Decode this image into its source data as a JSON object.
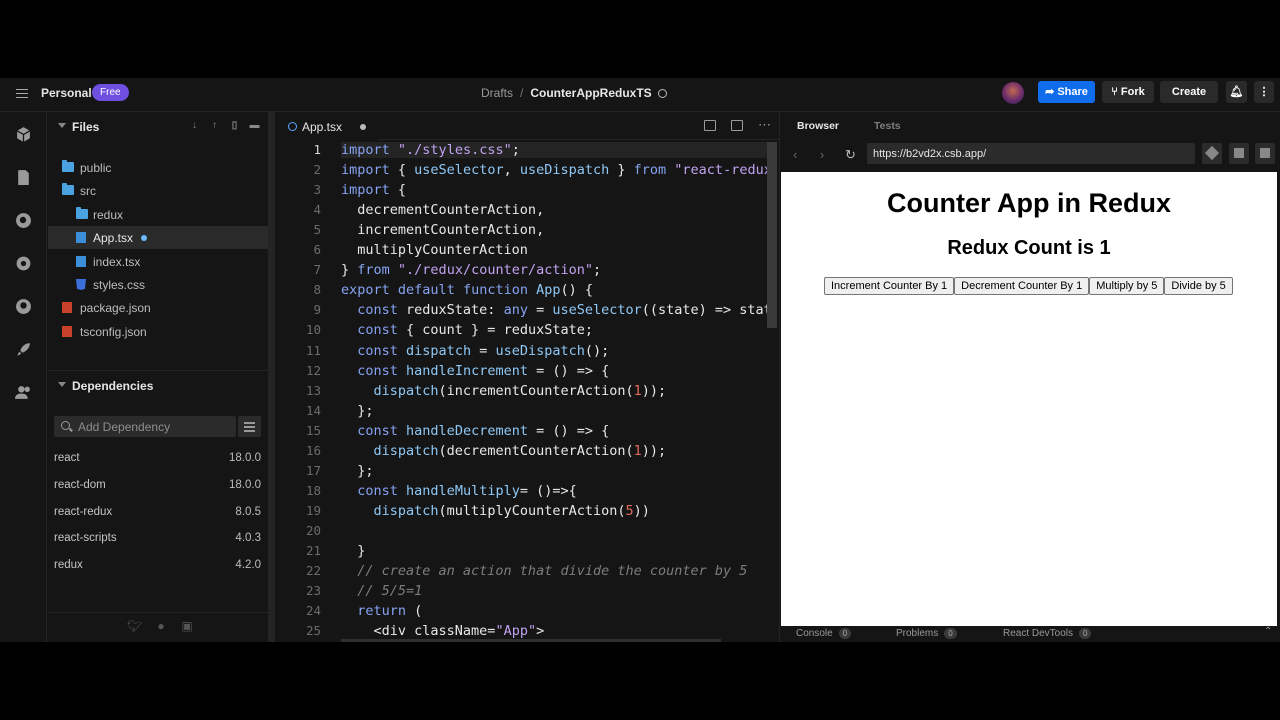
{
  "topbar": {
    "workspace": "Personal",
    "plan_badge": "Free",
    "breadcrumb_parent": "Drafts",
    "breadcrumb_sep": "/",
    "sandbox_name": "CounterAppReduxTS",
    "share_label": "Share",
    "fork_label": "Fork",
    "create_label": "Create"
  },
  "activity_icons": [
    "box-icon",
    "file-icon",
    "search-icon",
    "gear-icon",
    "github-icon",
    "rocket-icon",
    "users-icon"
  ],
  "files": {
    "header": "Files",
    "items": [
      {
        "name": "public",
        "kind": "folder",
        "depth": 0
      },
      {
        "name": "src",
        "kind": "folder",
        "depth": 0
      },
      {
        "name": "redux",
        "kind": "folder",
        "depth": 1
      },
      {
        "name": "App.tsx",
        "kind": "tsx",
        "depth": 1,
        "selected": true,
        "modified": true
      },
      {
        "name": "index.tsx",
        "kind": "tsx",
        "depth": 1
      },
      {
        "name": "styles.css",
        "kind": "css",
        "depth": 1
      },
      {
        "name": "package.json",
        "kind": "json",
        "depth": 0
      },
      {
        "name": "tsconfig.json",
        "kind": "json",
        "depth": 0
      }
    ]
  },
  "dependencies": {
    "header": "Dependencies",
    "search_placeholder": "Add Dependency",
    "items": [
      {
        "name": "react",
        "version": "18.0.0"
      },
      {
        "name": "react-dom",
        "version": "18.0.0"
      },
      {
        "name": "react-redux",
        "version": "8.0.5"
      },
      {
        "name": "react-scripts",
        "version": "4.0.3"
      },
      {
        "name": "redux",
        "version": "4.2.0"
      }
    ]
  },
  "editor": {
    "tab_label": "App.tsx",
    "line_numbers": [
      "1",
      "2",
      "3",
      "4",
      "5",
      "6",
      "7",
      "8",
      "9",
      "10",
      "11",
      "12",
      "13",
      "14",
      "15",
      "16",
      "17",
      "18",
      "19",
      "20",
      "21",
      "22",
      "23",
      "24",
      "25"
    ],
    "code_lines": [
      "import \"./styles.css\";",
      "import { useSelector, useDispatch } from \"react-redux\";",
      "import {",
      "  decrementCounterAction,",
      "  incrementCounterAction,",
      "  multiplyCounterAction",
      "} from \"./redux/counter/action\";",
      "export default function App() {",
      "  const reduxState: any = useSelector((state) => state);",
      "  const { count } = reduxState;",
      "  const dispatch = useDispatch();",
      "  const handleIncrement = () => {",
      "    dispatch(incrementCounterAction(1));",
      "  };",
      "  const handleDecrement = () => {",
      "    dispatch(decrementCounterAction(1));",
      "  };",
      "  const handleMultiply= ()=>{",
      "    dispatch(multiplyCounterAction(5))",
      "",
      "  }",
      "  // create an action that divide the counter by 5",
      "  // 5/5=1",
      "  return (",
      "    <div className=\"App\">"
    ]
  },
  "preview": {
    "tab_browser": "Browser",
    "tab_tests": "Tests",
    "url": "https://b2vd2x.csb.app/",
    "app_title": "Counter App in Redux",
    "count_text": "Redux Count is 1",
    "buttons": [
      "Increment Counter By 1",
      "Decrement Counter By 1",
      "Multiply by 5",
      "Divide by 5"
    ],
    "footer": [
      {
        "label": "Console",
        "count": "0"
      },
      {
        "label": "Problems",
        "count": "0"
      },
      {
        "label": "React DevTools",
        "count": "0"
      }
    ]
  }
}
